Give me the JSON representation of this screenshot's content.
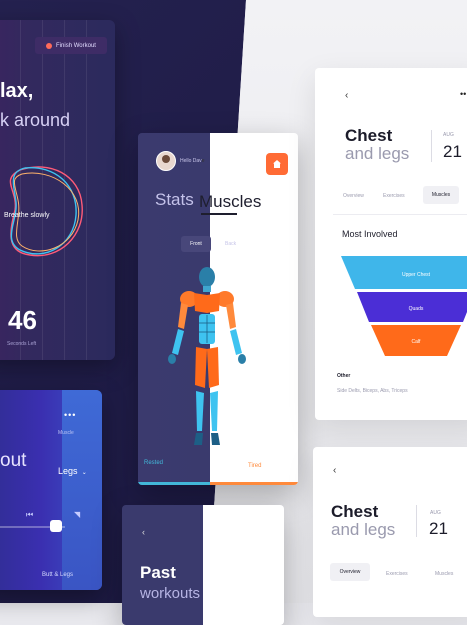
{
  "relax_card": {
    "back_label": "‹",
    "finish_label": "Finish Workout",
    "title": "lax,",
    "subtitle": "k around",
    "breathe_label": "Breathe slowly",
    "counter": "46",
    "counter_label": "Seconds Left"
  },
  "player_card": {
    "workout_word": "out",
    "target_label": "Muscle",
    "target_value": "Legs",
    "routine_label": "Butt & Legs",
    "progress": 0.1
  },
  "muscles_card": {
    "greeting": "Hello Dav",
    "greeting_tail": "e",
    "title_stats": "Stats",
    "title_muscles": "Muscles",
    "tab_front": "Front",
    "tab_back": "Back",
    "legend_rested": "Rested",
    "legend_tired": "Tired"
  },
  "past_card": {
    "title": "Past",
    "subtitle": "workouts"
  },
  "chest_card_top": {
    "title_line1": "Chest",
    "title_line2": "and legs",
    "month": "AUG",
    "day": "21",
    "tabs": [
      "Overview",
      "Exercises",
      "Muscles"
    ],
    "section_title": "Most Involved",
    "funnel": [
      {
        "label": "Upper Chest",
        "color": "#3fb6ea"
      },
      {
        "label": "Quads",
        "color": "#4b2ed6"
      },
      {
        "label": "Calf",
        "color": "#ff6a1a"
      }
    ],
    "other_label": "Other",
    "other_text": "Side Delts, Biceps, Abs, Triceps"
  },
  "chest_card_bottom": {
    "title_line1": "Chest",
    "title_line2": "and legs",
    "month": "AUG",
    "day": "21",
    "tabs": [
      "Overview",
      "Exercises",
      "Muscles"
    ]
  },
  "colors": {
    "accent_orange": "#ff6b35",
    "rested_blue": "#43b7d9",
    "tired_orange": "#ff8a3c",
    "dark_bg": "#24214f"
  }
}
